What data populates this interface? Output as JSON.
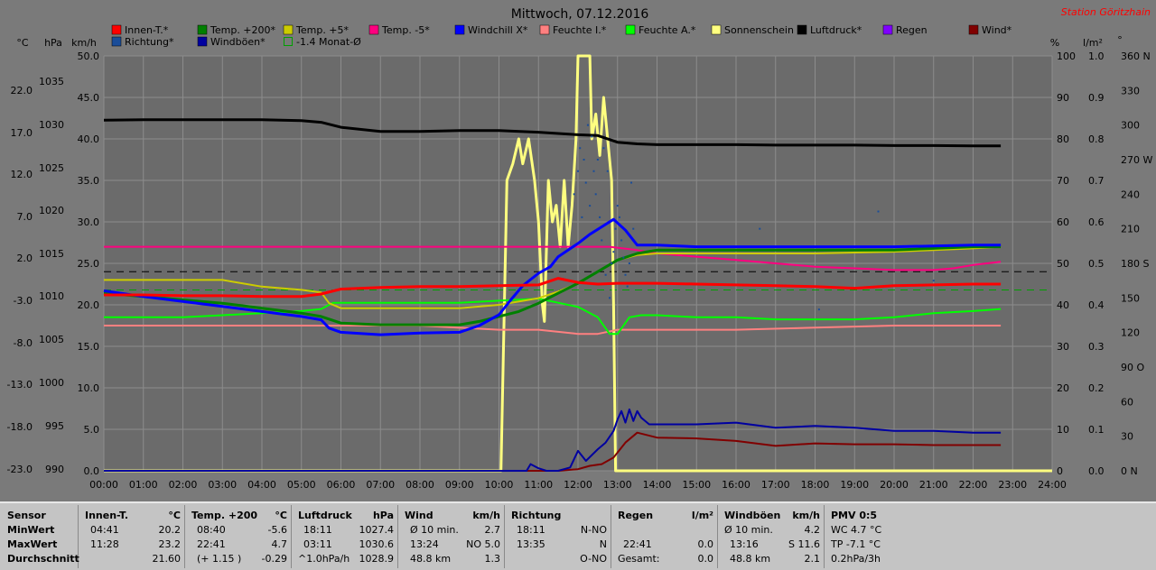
{
  "title": "Mittwoch, 07.12.2016",
  "station": "Station Göritzhain",
  "colors": {
    "bg": "#7a7a7a",
    "plot": "#6b6b6b",
    "grid": "#8c8c8c",
    "station": "#ff0000"
  },
  "chart_data": {
    "type": "line",
    "title": "Mittwoch, 07.12.2016",
    "axes": {
      "c_label": "°C",
      "c_ticks": [
        "22.0",
        "17.0",
        "12.0",
        "7.0",
        "2.0",
        "-3.0",
        "-8.0",
        "-13.0",
        "-18.0",
        "-23.0"
      ],
      "hpa_label": "hPa",
      "hpa_ticks": [
        "1035",
        "1030",
        "1025",
        "1020",
        "1015",
        "1010",
        "1005",
        "1000",
        "995",
        "990"
      ],
      "kmh_label": "km/h",
      "kmh_ticks": [
        "50.0",
        "45.0",
        "40.0",
        "35.0",
        "30.0",
        "25.0",
        "20.0",
        "15.0",
        "10.0",
        "5.0",
        "0.0"
      ],
      "pct_label": "%",
      "pct_ticks": [
        "100",
        "90",
        "80",
        "70",
        "60",
        "50",
        "40",
        "30",
        "20",
        "10",
        "0"
      ],
      "lm2_label": "l/m²",
      "lm2_ticks": [
        "1.0",
        "0.9",
        "0.8",
        "0.7",
        "0.6",
        "0.5",
        "0.4",
        "0.3",
        "0.2",
        "0.1",
        "0.0"
      ],
      "deg_label": "°",
      "deg_ticks": [
        "360 N",
        "330",
        "300",
        "270 W",
        "240",
        "210",
        "180 S",
        "150",
        "120",
        "90 O",
        "60",
        "30",
        "0 N"
      ],
      "x_ticks": [
        "00:00",
        "01:00",
        "02:00",
        "03:00",
        "04:00",
        "05:00",
        "06:00",
        "07:00",
        "08:00",
        "09:00",
        "10:00",
        "11:00",
        "12:00",
        "13:00",
        "14:00",
        "15:00",
        "16:00",
        "17:00",
        "18:00",
        "19:00",
        "20:00",
        "21:00",
        "22:00",
        "23:00",
        "24:00"
      ],
      "kmh_range": [
        0,
        50
      ],
      "pct_range": [
        0,
        100
      ],
      "deg_range": [
        0,
        360
      ],
      "hours": [
        0,
        24
      ]
    },
    "legend": [
      {
        "name": "Innen-T.*",
        "color": "#ff0000"
      },
      {
        "name": "Temp. +200*",
        "color": "#008000"
      },
      {
        "name": "Temp. +5*",
        "color": "#cccc00"
      },
      {
        "name": "Temp. -5*",
        "color": "#ff0080"
      },
      {
        "name": "Windchill X*",
        "color": "#0000ff"
      },
      {
        "name": "Feuchte I.*",
        "color": "#ff8080"
      },
      {
        "name": "Feuchte A.*",
        "color": "#00ff00"
      },
      {
        "name": "Sonnenschein",
        "color": "#ffff80"
      },
      {
        "name": "Luftdruck*",
        "color": "#000000"
      },
      {
        "name": "Regen",
        "color": "#8000ff"
      },
      {
        "name": "Wind*",
        "color": "#800000"
      },
      {
        "name": "Richtung*",
        "color": "#1a4d99"
      },
      {
        "name": "Windböen*",
        "color": "#0000a0"
      },
      {
        "name": "-1.4 Monat-Ø",
        "color": "#00a000",
        "hollow": true
      }
    ],
    "series": [
      {
        "name": "Innen-T.*",
        "color": "#ff0000",
        "width": 3,
        "x": [
          0,
          1,
          2,
          3,
          4,
          5,
          5.5,
          6,
          7,
          8,
          9,
          10,
          11,
          11.5,
          12,
          12.5,
          13,
          14,
          15,
          16,
          17,
          18,
          19,
          20,
          21,
          22,
          22.7
        ],
        "y": [
          21.2,
          21.2,
          21.1,
          21.1,
          21.0,
          21.0,
          21.3,
          21.9,
          22.1,
          22.2,
          22.2,
          22.3,
          22.4,
          23.2,
          22.7,
          22.5,
          22.6,
          22.6,
          22.5,
          22.4,
          22.3,
          22.2,
          22.0,
          22.3,
          22.4,
          22.5,
          22.5
        ]
      },
      {
        "name": "Temp. +200*",
        "color": "#008000",
        "width": 3,
        "x": [
          0,
          1,
          2,
          3,
          4,
          5,
          5.5,
          6,
          7,
          8,
          9,
          9.5,
          10,
          10.5,
          11,
          11.5,
          12,
          12.5,
          13,
          13.5,
          14,
          15,
          16,
          17,
          18,
          19,
          20,
          21,
          22,
          22.7
        ],
        "y": [
          21.4,
          21.0,
          20.6,
          20.2,
          19.6,
          19.0,
          18.6,
          17.8,
          17.6,
          17.6,
          17.6,
          18.0,
          18.6,
          19.2,
          20.2,
          21.4,
          22.6,
          24.0,
          25.4,
          26.2,
          26.6,
          26.6,
          26.6,
          26.6,
          26.6,
          26.6,
          26.6,
          26.8,
          27.0,
          27.0
        ]
      },
      {
        "name": "Temp. +5*",
        "color": "#cccc00",
        "width": 2,
        "x": [
          0,
          1,
          2,
          3,
          3.5,
          4,
          4.5,
          5,
          5.5,
          5.7,
          6,
          7,
          8,
          9,
          10,
          11,
          11.5,
          12,
          12.5,
          13,
          13.5,
          14,
          15,
          16,
          17,
          18,
          19,
          20,
          21,
          22,
          22.7
        ],
        "y": [
          23.0,
          23.0,
          23.0,
          23.0,
          22.6,
          22.2,
          22.0,
          21.8,
          21.5,
          20.2,
          19.6,
          19.6,
          19.6,
          19.6,
          20.0,
          20.8,
          21.6,
          22.6,
          24.0,
          25.4,
          26.0,
          26.2,
          26.2,
          26.2,
          26.2,
          26.2,
          26.3,
          26.4,
          26.6,
          26.8,
          27.0
        ]
      },
      {
        "name": "Temp. -5*",
        "color": "#ff0080",
        "width": 2,
        "x": [
          0,
          2,
          4,
          6,
          8,
          10,
          12,
          12.8,
          13.5,
          14,
          15,
          16,
          17,
          18,
          19,
          20,
          21,
          21.5,
          22,
          22.7
        ],
        "y": [
          27.0,
          27.0,
          27.0,
          27.0,
          27.0,
          27.0,
          27.0,
          27.0,
          26.6,
          26.2,
          25.8,
          25.4,
          25.0,
          24.6,
          24.4,
          24.2,
          24.2,
          24.4,
          24.8,
          25.2
        ]
      },
      {
        "name": "Windchill X*",
        "color": "#0000ff",
        "width": 3,
        "x": [
          0,
          1,
          2,
          3,
          4,
          5,
          5.5,
          5.7,
          6,
          7,
          8,
          9,
          9.5,
          10,
          10.3,
          10.6,
          11,
          11.3,
          11.5,
          12,
          12.3,
          12.6,
          12.9,
          13.2,
          13.5,
          14,
          15,
          16,
          17,
          18,
          19,
          20,
          21,
          22,
          22.7
        ],
        "y": [
          21.7,
          21.0,
          20.4,
          19.8,
          19.2,
          18.6,
          18.2,
          17.2,
          16.7,
          16.4,
          16.6,
          16.7,
          17.5,
          18.8,
          20.6,
          22.3,
          23.8,
          24.6,
          25.8,
          27.4,
          28.5,
          29.4,
          30.3,
          29.0,
          27.2,
          27.2,
          27.0,
          27.0,
          27.0,
          27.0,
          27.0,
          27.0,
          27.1,
          27.2,
          27.2
        ]
      },
      {
        "name": "Feuchte I.*",
        "color": "#ff8080",
        "width": 2,
        "x": [
          0,
          2,
          4,
          6,
          8,
          10,
          11,
          11.5,
          12,
          12.5,
          13,
          14,
          16,
          18,
          20,
          22,
          22.7
        ],
        "y": [
          35,
          35,
          35,
          35,
          35,
          34,
          34,
          33.5,
          33,
          33,
          34,
          34,
          34,
          34.5,
          35,
          35,
          35
        ]
      },
      {
        "name": "Feuchte A.*",
        "color": "#00ff00",
        "width": 2,
        "x": [
          0,
          1,
          2,
          3,
          4,
          5,
          5.5,
          5.8,
          6,
          7,
          8,
          9,
          10,
          11,
          11.5,
          12,
          12.5,
          12.8,
          13,
          13.3,
          13.6,
          14,
          15,
          16,
          17,
          18,
          19,
          20,
          21,
          22,
          22.7
        ],
        "y": [
          37,
          37,
          37,
          37.5,
          38,
          38.5,
          39,
          40.5,
          40.5,
          40.5,
          40.5,
          40.5,
          41,
          41.5,
          40.5,
          39.5,
          37,
          33,
          33,
          37,
          37.5,
          37.5,
          37,
          37,
          36.5,
          36.5,
          36.5,
          37,
          38,
          38.5,
          39
        ]
      },
      {
        "name": "Luftdruck*",
        "color": "#000000",
        "width": 3,
        "x": [
          0,
          1,
          2,
          3,
          4,
          5,
          5.5,
          6,
          7,
          8,
          9,
          10,
          11,
          12,
          12.5,
          13,
          13.5,
          14,
          15,
          16,
          17,
          18,
          19,
          20,
          21,
          22,
          22.7
        ],
        "y": [
          84.5,
          84.6,
          84.6,
          84.6,
          84.6,
          84.4,
          84.0,
          82.8,
          81.8,
          81.8,
          82.0,
          82.0,
          81.6,
          81.0,
          80.8,
          79.2,
          78.8,
          78.6,
          78.6,
          78.6,
          78.5,
          78.5,
          78.5,
          78.4,
          78.4,
          78.3,
          78.3
        ]
      },
      {
        "name": "Wind*",
        "color": "#800000",
        "width": 2,
        "x": [
          0,
          11.5,
          12,
          12.3,
          12.6,
          12.9,
          13.2,
          13.5,
          14,
          15,
          16,
          17,
          18,
          19,
          20,
          21,
          22,
          22.7
        ],
        "y": [
          0,
          0,
          0.2,
          0.6,
          0.8,
          1.6,
          3.4,
          4.6,
          4.0,
          3.9,
          3.6,
          3.0,
          3.3,
          3.2,
          3.2,
          3.1,
          3.1,
          3.1
        ]
      },
      {
        "name": "Windböen*",
        "color": "#0000a0",
        "width": 2,
        "x": [
          0,
          10.7,
          10.8,
          11.0,
          11.2,
          11.5,
          11.8,
          12.0,
          12.2,
          12.5,
          12.7,
          12.9,
          13.0,
          13.1,
          13.2,
          13.3,
          13.4,
          13.5,
          13.6,
          13.8,
          14,
          15,
          16,
          17,
          18,
          19,
          20,
          21,
          22,
          22.7
        ],
        "y": [
          0,
          0,
          0.8,
          0.3,
          0,
          0,
          0.4,
          2.4,
          1.2,
          2.6,
          3.4,
          4.8,
          6.2,
          7.2,
          5.8,
          7.4,
          6.0,
          7.2,
          6.4,
          5.6,
          5.6,
          5.6,
          5.8,
          5.2,
          5.4,
          5.2,
          4.8,
          4.8,
          4.6,
          4.6
        ]
      },
      {
        "name": "Sonnenschein",
        "color": "#ffff80",
        "width": 3,
        "x": [
          0,
          10.0,
          10.05,
          10.2,
          10.35,
          10.5,
          10.6,
          10.75,
          10.9,
          11.0,
          11.1,
          11.15,
          11.25,
          11.35,
          11.45,
          11.55,
          11.65,
          11.75,
          11.85,
          11.95,
          12.0,
          12.3,
          12.35,
          12.45,
          12.55,
          12.65,
          12.75,
          12.85,
          12.9,
          12.95,
          24
        ],
        "y": [
          0,
          0,
          0,
          70,
          74,
          80,
          74,
          80,
          70,
          60,
          40,
          36,
          70,
          60,
          64,
          54,
          70,
          54,
          64,
          80,
          100,
          100,
          80,
          86,
          76,
          90,
          80,
          70,
          40,
          0,
          0
        ]
      }
    ],
    "direction_points": {
      "name": "Richtung*",
      "color": "#1a4d99",
      "x": [
        11.9,
        12.0,
        12.05,
        12.1,
        12.15,
        12.2,
        12.25,
        12.3,
        12.35,
        12.4,
        12.45,
        12.5,
        12.55,
        12.6,
        12.65,
        12.7,
        12.75,
        12.8,
        12.85,
        12.9,
        12.95,
        13.0,
        13.05,
        13.1,
        13.15,
        13.2,
        13.25,
        13.3,
        13.35,
        13.4,
        16.6,
        18.1,
        19.6,
        21.0
      ],
      "y": [
        240,
        260,
        280,
        220,
        270,
        250,
        300,
        230,
        290,
        260,
        240,
        270,
        220,
        200,
        280,
        170,
        260,
        150,
        180,
        190,
        210,
        230,
        220,
        200,
        185,
        170,
        160,
        180,
        250,
        210,
        210,
        140,
        225,
        165
      ]
    },
    "reference_lines": [
      {
        "name": "Temp. +5* Ref",
        "color": "#000000",
        "axis": "kmh",
        "y": 24.0,
        "dash": "8,6"
      },
      {
        "name": "-1.4 Monat-Ø",
        "color": "#00a000",
        "axis": "kmh",
        "y": 21.8,
        "dash": "8,6"
      }
    ]
  },
  "stats": {
    "col1": {
      "header": "Sensor",
      "rows": [
        "MinWert",
        "MaxWert",
        "Durchschnitt"
      ]
    },
    "col2": {
      "header": "Innen-T.",
      "unit": "°C",
      "rows": [
        [
          "04:41",
          "20.2"
        ],
        [
          "11:28",
          "23.2"
        ],
        [
          "",
          "21.60"
        ]
      ]
    },
    "col3": {
      "header": "Temp. +200",
      "unit": "°C",
      "rows": [
        [
          "08:40",
          "-5.6"
        ],
        [
          "22:41",
          "4.7"
        ],
        [
          "(+ 1.15 )",
          "-0.29"
        ]
      ]
    },
    "col4": {
      "header": "Luftdruck",
      "unit": "hPa",
      "rows": [
        [
          "18:11",
          "1027.4"
        ],
        [
          "03:11",
          "1030.6"
        ],
        [
          "^1.0hPa/h",
          "1028.9"
        ]
      ]
    },
    "col5": {
      "header": "Wind",
      "unit": "km/h",
      "rows": [
        [
          "Ø 10 min.",
          "2.7"
        ],
        [
          "13:24",
          "NO 5.0"
        ],
        [
          "48.8 km",
          "1.3"
        ]
      ]
    },
    "col6": {
      "header": "Richtung",
      "unit": "",
      "rows": [
        [
          "18:11",
          "N-NO"
        ],
        [
          "13:35",
          "N"
        ],
        [
          "",
          "O-NO"
        ]
      ]
    },
    "col7": {
      "header": "Regen",
      "unit": "l/m²",
      "rows": [
        [
          "",
          ""
        ],
        [
          "22:41",
          "0.0"
        ],
        [
          "Gesamt:",
          "0.0"
        ]
      ]
    },
    "col8": {
      "header": "Windböen",
      "unit": "km/h",
      "rows": [
        [
          "Ø 10 min.",
          "4.2"
        ],
        [
          "13:16",
          "S 11.6"
        ],
        [
          "48.8 km",
          "2.1"
        ]
      ]
    },
    "col9": {
      "header": "PMV 0:5",
      "unit": "",
      "rows": [
        [
          "WC 4.7 °C",
          ""
        ],
        [
          "TP -7.1 °C",
          ""
        ],
        [
          "0.2hPa/3h",
          ""
        ]
      ]
    }
  }
}
